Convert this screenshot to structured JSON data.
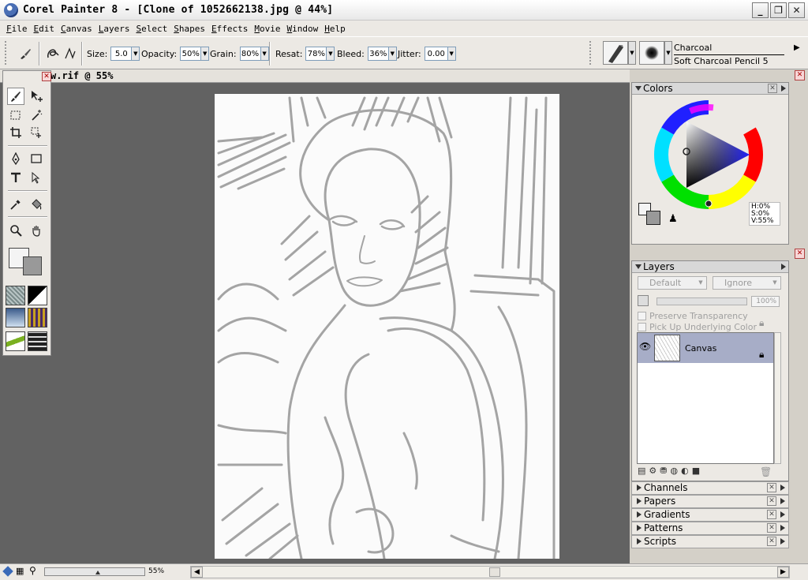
{
  "window": {
    "title": "Corel Painter 8 - [Clone of 1052662138.jpg @ 44%]",
    "minimize_glyph": "_",
    "restore_glyph": "❐",
    "close_glyph": "✕"
  },
  "menu": [
    "File",
    "Edit",
    "Canvas",
    "Layers",
    "Select",
    "Shapes",
    "Effects",
    "Movie",
    "Window",
    "Help"
  ],
  "property_bar": {
    "size_label": "Size:",
    "size_value": "5.0",
    "opacity_label": "Opacity:",
    "opacity_value": "50%",
    "grain_label": "Grain:",
    "grain_value": "80%",
    "resat_label": "Resat:",
    "resat_value": "78%",
    "bleed_label": "Bleed:",
    "bleed_value": "36%",
    "jitter_label": "Jitter:",
    "jitter_value": "0.00",
    "brush_category": "Charcoal",
    "brush_variant": "Soft Charcoal Pencil 5"
  },
  "document": {
    "title": "w.rif @ 55%"
  },
  "palettes": {
    "colors": {
      "title": "Colors",
      "h_value": "H:0%",
      "s_value": "S:0%",
      "v_value": "V:55%",
      "main_color": "#f4f4f4",
      "additional_color": "#999999"
    },
    "layers": {
      "title": "Layers",
      "composite_method": "Default",
      "composite_depth": "Ignore",
      "opacity_value": "100%",
      "preserve_transparency": "Preserve Transparency",
      "pick_up_underlying": "Pick Up Underlying Color",
      "layer_name": "Canvas"
    },
    "collapsed": [
      "Channels",
      "Papers",
      "Gradients",
      "Patterns",
      "Scripts"
    ]
  },
  "status": {
    "zoom_value": "55%"
  }
}
